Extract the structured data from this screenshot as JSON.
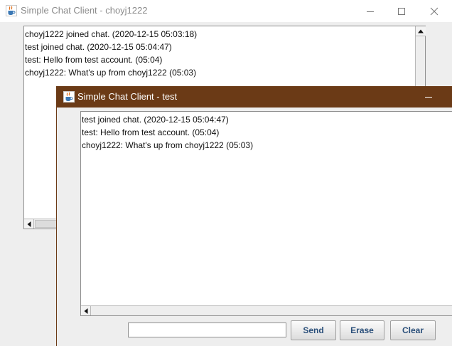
{
  "back_window": {
    "title": "Simple Chat Client - choyj1222",
    "messages": [
      "choyj1222 joined chat. (2020-12-15 05:03:18)",
      "test joined chat. (2020-12-15 05:04:47)",
      "test: Hello from test account. (05:04)",
      "choyj1222: What's up from choyj1222 (05:03)"
    ]
  },
  "front_window": {
    "title": "Simple Chat Client - test",
    "messages": [
      "test joined chat. (2020-12-15 05:04:47)",
      "test: Hello from test account. (05:04)",
      "choyj1222: What's up from choyj1222 (05:03)"
    ],
    "input": {
      "value": "",
      "placeholder": ""
    },
    "buttons": {
      "send": "Send",
      "erase": "Erase",
      "clear": "Clear"
    }
  },
  "colors": {
    "active_titlebar": "#6b3a16",
    "button_text": "#2a4f7a"
  },
  "icons": [
    "java-app-icon",
    "minimize-icon",
    "maximize-icon",
    "close-icon",
    "scroll-up-arrow-icon",
    "scroll-left-arrow-icon"
  ]
}
